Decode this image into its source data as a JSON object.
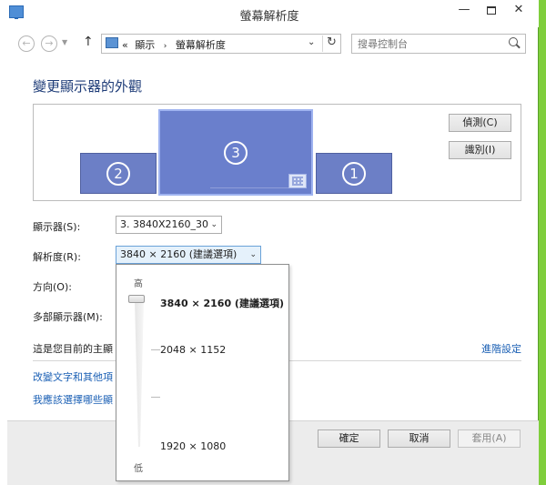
{
  "window": {
    "title": "螢幕解析度"
  },
  "address_bar": {
    "prefix": "«",
    "crumb_1": "顯示",
    "separator": "›",
    "crumb_2": "螢幕解析度",
    "search_placeholder": "搜尋控制台"
  },
  "main": {
    "heading": "變更顯示器的外觀",
    "monitors": [
      "2",
      "3",
      "1"
    ],
    "detect_label": "偵測(C)",
    "identify_label": "識別(I)",
    "display_label": "顯示器(S):",
    "display_value": "3. 3840X2160_30",
    "resolution_label": "解析度(R):",
    "resolution_value": "3840 × 2160 (建議選項)",
    "orientation_label": "方向(O):",
    "multi_display_label": "多部顯示器(M):",
    "primary_text": "這是您目前的主顯",
    "advanced_link": "進階設定",
    "link_text_size": "改變文字和其他項",
    "link_which_settings": "我應該選擇哪些顯"
  },
  "footer": {
    "ok_label": "確定",
    "cancel_label": "取消",
    "apply_label": "套用(A)"
  },
  "resolution_popup": {
    "high_label": "高",
    "low_label": "低",
    "options": [
      "3840 × 2160 (建議選項)",
      "2048 × 1152",
      "1920 × 1080"
    ],
    "selected": "3840 × 2160 (建議選項)"
  },
  "colors": {
    "monitor_fill": "#6c7fc6",
    "heading": "#1e3c78",
    "link": "#1a5fb4"
  }
}
